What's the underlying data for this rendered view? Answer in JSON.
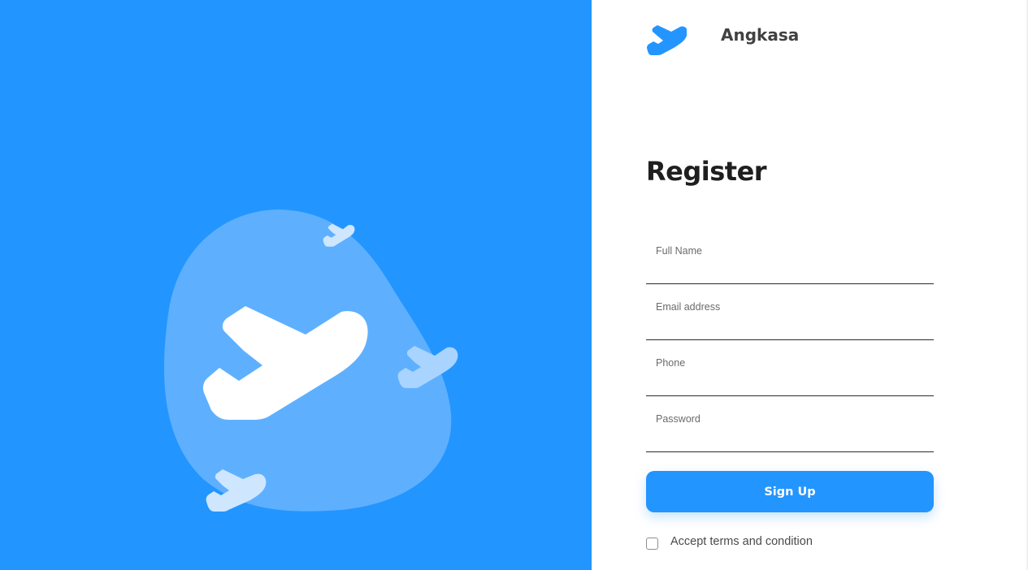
{
  "colors": {
    "primary": "#2395ff",
    "hero_background": "#2395ff",
    "blob": "#5eb0ff",
    "text_dark": "#1f1f1f"
  },
  "brand": {
    "name": "Angkasa",
    "logo_icon": "plane-icon"
  },
  "hero": {
    "illustration": "plane-illustration",
    "icons": [
      "plane-icon",
      "plane-icon",
      "plane-icon",
      "plane-icon"
    ]
  },
  "form": {
    "title": "Register",
    "full_name": {
      "placeholder": "Full Name",
      "value": ""
    },
    "email": {
      "placeholder": "Email address",
      "value": ""
    },
    "phone": {
      "placeholder": "Phone",
      "value": ""
    },
    "password": {
      "placeholder": "Password",
      "value": ""
    },
    "submit_label": "Sign Up",
    "terms_label": "Accept terms and condition",
    "terms_checked": false
  }
}
